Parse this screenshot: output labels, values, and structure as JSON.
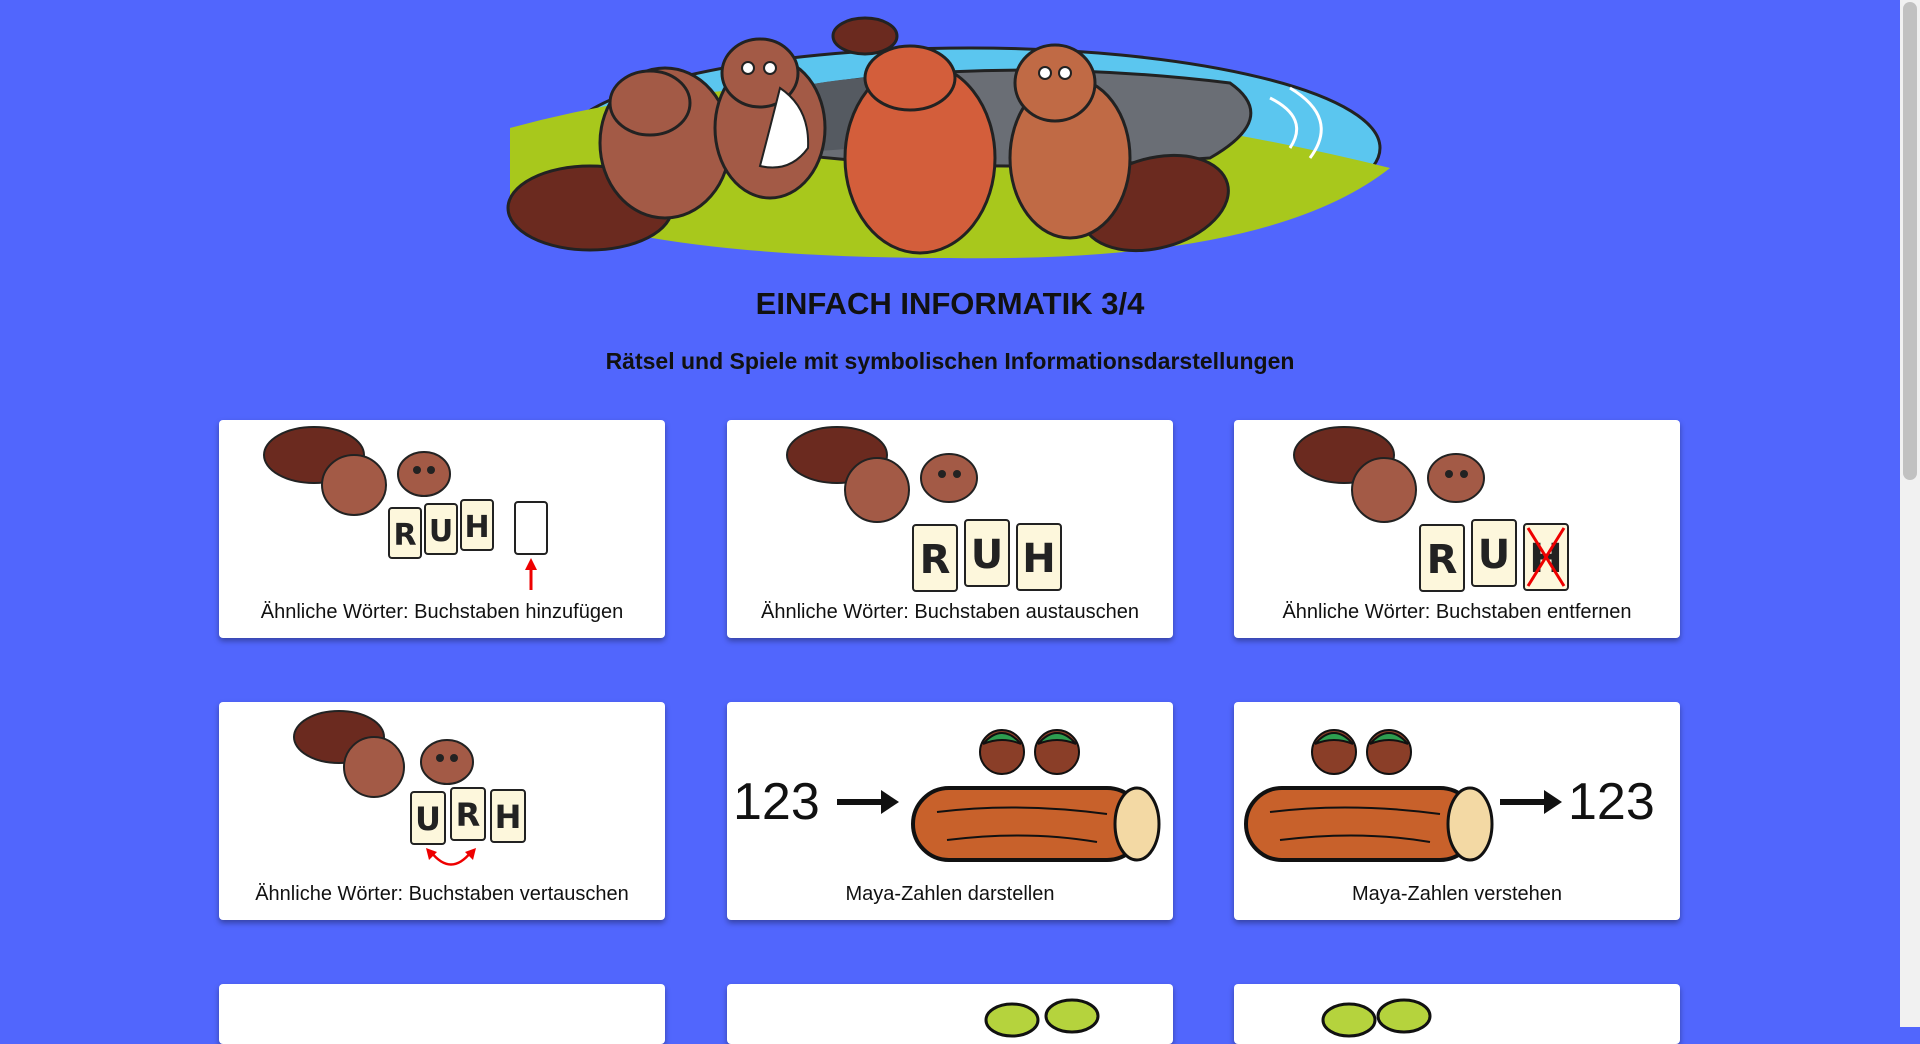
{
  "header": {
    "title": "EINFACH INFORMATIK 3/4",
    "subtitle": "Rätsel und Spiele mit symbolischen Informationsdarstellungen"
  },
  "cards": [
    {
      "label": "Ähnliche Wörter: Buchstaben hinzufügen",
      "letters": [
        "R",
        "U",
        "H",
        ""
      ],
      "icon": "beaver-add-letter-icon"
    },
    {
      "label": "Ähnliche Wörter: Buchstaben austauschen",
      "letters": [
        "R",
        "U",
        "H"
      ],
      "icon": "beaver-swap-letter-icon"
    },
    {
      "label": "Ähnliche Wörter: Buchstaben entfernen",
      "letters": [
        "R",
        "U",
        "H"
      ],
      "icon": "beaver-remove-letter-icon"
    },
    {
      "label": "Ähnliche Wörter: Buchstaben vertauschen",
      "letters": [
        "U",
        "R",
        "H"
      ],
      "icon": "beaver-permute-letter-icon"
    },
    {
      "label": "Maya-Zahlen darstellen",
      "number": "123",
      "icon": "number-to-log-icon"
    },
    {
      "label": "Maya-Zahlen verstehen",
      "number": "123",
      "icon": "log-to-number-icon"
    }
  ],
  "colors": {
    "background": "#5166fd",
    "card": "#ffffff",
    "beaver": "#a0522d",
    "log": "#c8612b"
  }
}
